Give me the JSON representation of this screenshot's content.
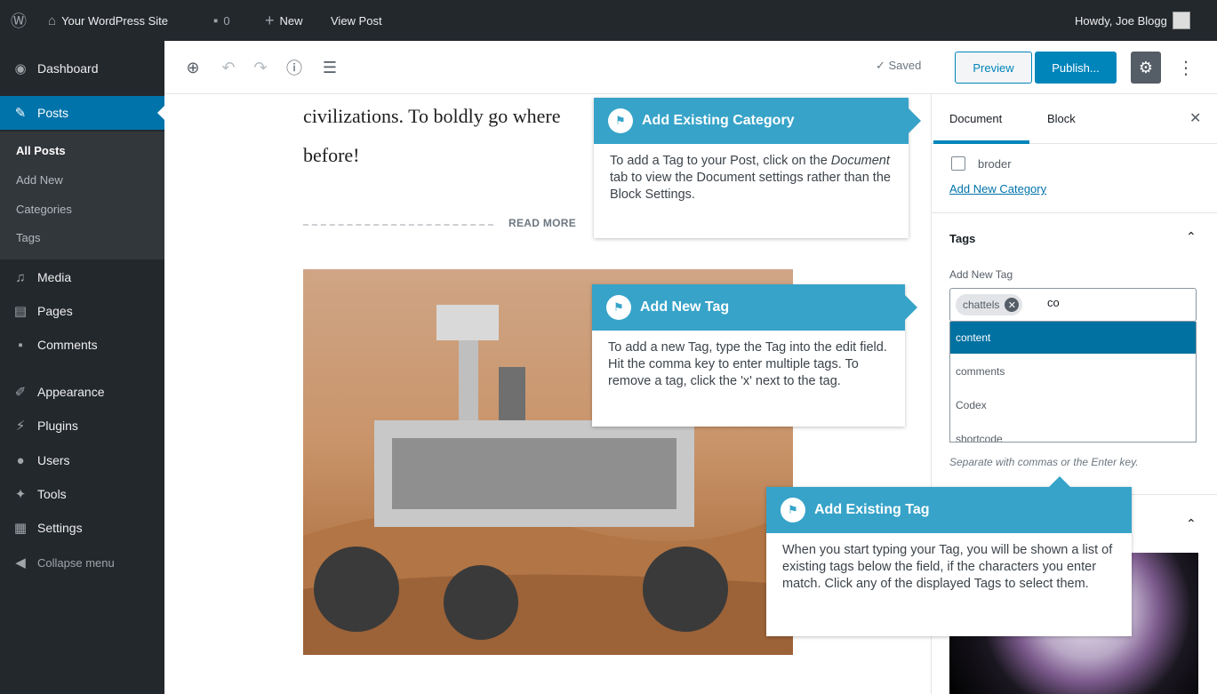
{
  "adminbar": {
    "site_name": "Your WordPress Site",
    "comments_count": "0",
    "new_label": "New",
    "view_post_label": "View Post",
    "howdy": "Howdy, Joe Blogg"
  },
  "menu": {
    "dashboard": "Dashboard",
    "posts": "Posts",
    "submenu": {
      "all_posts": "All Posts",
      "add_new": "Add New",
      "categories": "Categories",
      "tags": "Tags"
    },
    "media": "Media",
    "pages": "Pages",
    "comments": "Comments",
    "appearance": "Appearance",
    "plugins": "Plugins",
    "users": "Users",
    "tools": "Tools",
    "settings": "Settings",
    "collapse": "Collapse menu"
  },
  "toolbar": {
    "saved": "✓ Saved",
    "preview": "Preview",
    "publish": "Publish..."
  },
  "post": {
    "line1": "civilizations. To boldly go where",
    "line2": "before!",
    "read_more": "READ MORE"
  },
  "sidebar": {
    "tab_document": "Document",
    "tab_block": "Block",
    "category_item": "broder",
    "add_new_category": "Add New Category",
    "tags_heading": "Tags",
    "add_new_tag_label": "Add New Tag",
    "chip": "chattels",
    "input_value": "co",
    "suggestions": [
      "content",
      "comments",
      "Codex",
      "shortcode"
    ],
    "help": "Separate with commas or the Enter key."
  },
  "callouts": {
    "existing_category": {
      "title": "Add Existing Category",
      "body_pre": "To add a Tag to your Post, click on the ",
      "body_em": "Document",
      "body_post": " tab to view the Document settings rather than the Block Settings."
    },
    "new_tag": {
      "title": "Add New Tag",
      "body": "To add a new Tag, type the Tag into the edit field. Hit the comma key to enter multiple tags. To remove a tag, click the 'x' next to the tag."
    },
    "existing_tag": {
      "title": "Add Existing Tag",
      "body": "When you start typing your Tag, you will be shown a list of existing tags below the field, if the characters you enter match. Click any of the displayed Tags to select them."
    }
  },
  "colors": {
    "admin_bg": "#23282d",
    "accent": "#0073aa",
    "callout": "#37a3c9"
  }
}
